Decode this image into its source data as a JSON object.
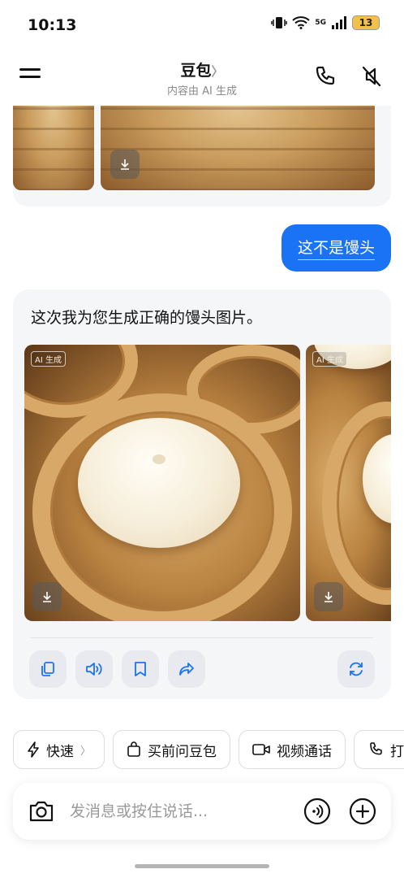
{
  "status_bar": {
    "time": "10:13",
    "network": "5G",
    "battery": "13"
  },
  "header": {
    "title": "豆包",
    "title_chevron": "〉",
    "subtitle": "内容由 AI 生成"
  },
  "messages": {
    "user": "这不是馒头",
    "bot": "这次我为您生成正确的馒头图片。",
    "image_tags": [
      "AI 生成",
      "AI 生成"
    ]
  },
  "chips": [
    {
      "label": "快速",
      "has_arrow": true
    },
    {
      "label": "买前问豆包"
    },
    {
      "label": "视频通话"
    },
    {
      "label": "打电话"
    }
  ],
  "chip_arrow": "〉",
  "input": {
    "placeholder": "发消息或按住说话..."
  },
  "colors": {
    "accent": "#1a73f5",
    "card_bg": "#f5f6f8",
    "action_bg": "#e8eaef"
  }
}
